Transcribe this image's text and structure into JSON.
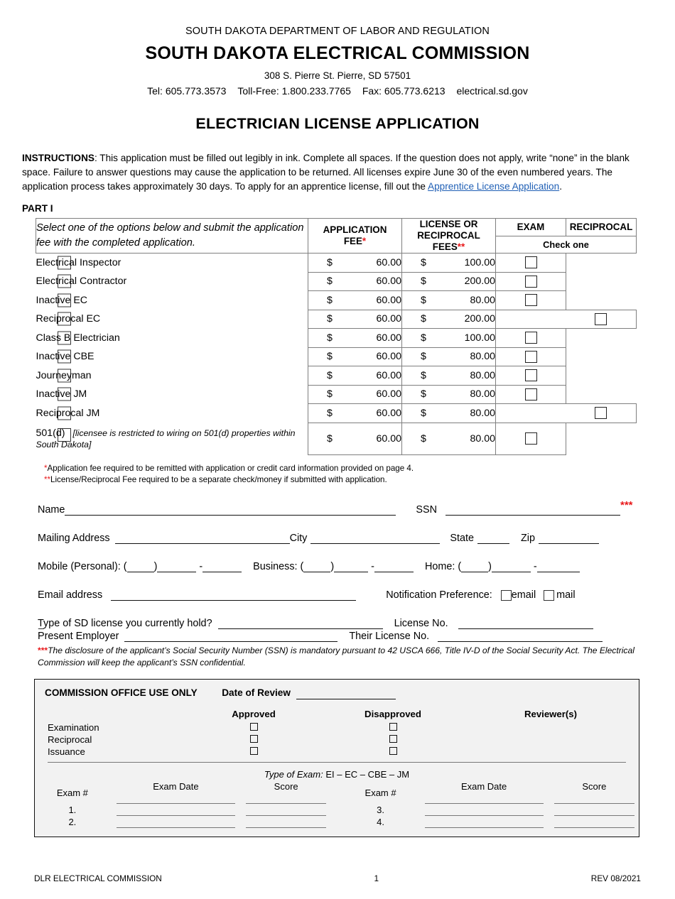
{
  "header": {
    "department": "SOUTH DAKOTA DEPARTMENT OF LABOR AND REGULATION",
    "commission": "SOUTH DAKOTA ELECTRICAL COMMISSION",
    "address": "308 S. Pierre St. Pierre, SD 57501",
    "tel": "Tel: 605.773.3573",
    "toll_free": "Toll-Free: 1.800.233.7765",
    "fax": "Fax: 605.773.6213",
    "website": "electrical.sd.gov",
    "doc_title": "ELECTRICIAN LICENSE APPLICATION"
  },
  "instructions": {
    "label": "INSTRUCTIONS",
    "body_before_link": ": This application must be filled out legibly in ink. Complete all spaces. If the question does not apply, write “none” in the blank space.  Failure to answer questions may cause the application to be returned. All licenses expire June 30 of the even numbered years. The application process takes approximately 30 days. To apply for an apprentice license, fill out the ",
    "link_text": "Apprentice License Application",
    "body_after_link": ".",
    "link_color": "#1f5fb5"
  },
  "part_label": "PART I",
  "fee_table": {
    "select_note": "Select one of the options below and submit the application fee with the completed application.",
    "columns": {
      "application_fee": "APPLICATION FEE",
      "application_fee_marker": "*",
      "license_fee": "LICENSE OR RECIPROCAL FEES",
      "license_fee_marker": "**",
      "exam": "EXAM",
      "reciprocal": "RECIPROCAL",
      "check_one": "Check one"
    },
    "rows": [
      {
        "label": "Electrical Inspector",
        "note": "",
        "application_fee": "60.00",
        "license_fee": "100.00",
        "exam_checkbox": true,
        "reciprocal_checkbox": false
      },
      {
        "label": "Electrical Contractor",
        "note": "",
        "application_fee": "60.00",
        "license_fee": "200.00",
        "exam_checkbox": true,
        "reciprocal_checkbox": false
      },
      {
        "label": "Inactive EC",
        "note": "",
        "application_fee": "60.00",
        "license_fee": "80.00",
        "exam_checkbox": true,
        "reciprocal_checkbox": false
      },
      {
        "label": "Reciprocal EC",
        "note": "",
        "application_fee": "60.00",
        "license_fee": "200.00",
        "exam_checkbox": false,
        "reciprocal_checkbox": true
      },
      {
        "label": "Class B Electrician",
        "note": "",
        "application_fee": "60.00",
        "license_fee": "100.00",
        "exam_checkbox": true,
        "reciprocal_checkbox": false
      },
      {
        "label": "Inactive CBE",
        "note": "",
        "application_fee": "60.00",
        "license_fee": "80.00",
        "exam_checkbox": true,
        "reciprocal_checkbox": false
      },
      {
        "label": "Journeyman",
        "note": "",
        "application_fee": "60.00",
        "license_fee": "80.00",
        "exam_checkbox": true,
        "reciprocal_checkbox": false
      },
      {
        "label": "Inactive JM",
        "note": "",
        "application_fee": "60.00",
        "license_fee": "80.00",
        "exam_checkbox": true,
        "reciprocal_checkbox": false
      },
      {
        "label": "Reciprocal JM",
        "note": "",
        "application_fee": "60.00",
        "license_fee": "80.00",
        "exam_checkbox": false,
        "reciprocal_checkbox": true
      },
      {
        "label": "501(d)",
        "note": " - [licensee is restricted to wiring on 501(d) properties within South Dakota]",
        "application_fee": "60.00",
        "license_fee": "80.00",
        "exam_checkbox": true,
        "reciprocal_checkbox": false
      }
    ],
    "currency_symbol": "$"
  },
  "footnotes": {
    "one_marker": "*",
    "one": "Application fee required to be remitted with application or credit card information provided on page 4.",
    "two_marker": "**",
    "two": "License/Reciprocal Fee required to be a separate check/money if submitted with application."
  },
  "form": {
    "name_label": "Name",
    "ssn_label": "SSN",
    "ssn_marker": "***",
    "mailing_label": "Mailing Address",
    "city_label": "City",
    "state_label": "State",
    "zip_label": "Zip",
    "mobile_label": "Mobile (Personal): (",
    "mobile_mid": ")",
    "dash": "-",
    "business_label": "Business: (",
    "home_label": "Home: (",
    "email_label": "Email address",
    "notification_label": "Notification Preference:",
    "notification_email": "email",
    "notification_mail": "mail",
    "license_type_label": "Type of SD license you currently hold?",
    "license_no_label": "License No.",
    "stray_dash": "_",
    "employer_label": "Present Employer",
    "their_license_label": "Their License No."
  },
  "ssn_note": {
    "stars": "***",
    "text": "The disclosure of the applicant’s Social Security Number (SSN) is mandatory pursuant to 42 USCA 666, Title IV-D of the Social Security Act. The Electrical Commission will keep the applicant’s SSN confidential."
  },
  "office_use": {
    "title": "COMMISSION OFFICE USE ONLY",
    "date_label": "Date of Review",
    "approved": "Approved",
    "disapproved": "Disapproved",
    "reviewers": "Reviewer(s)",
    "rows": [
      "Examination",
      "Reciprocal",
      "Issuance"
    ],
    "exam_type_label": "Type of Exam:",
    "exam_type_values": "EI  –  EC  –  CBE  –  JM",
    "exam_headers": {
      "exam_num": "Exam #",
      "exam_date": "Exam Date",
      "score": "Score"
    },
    "exam_left_rows": [
      "1.",
      "2."
    ],
    "exam_right_rows": [
      "3.",
      "4."
    ]
  },
  "footer": {
    "left": "DLR ELECTRICAL COMMISSION",
    "center": "1",
    "right": "REV 08/2021"
  }
}
